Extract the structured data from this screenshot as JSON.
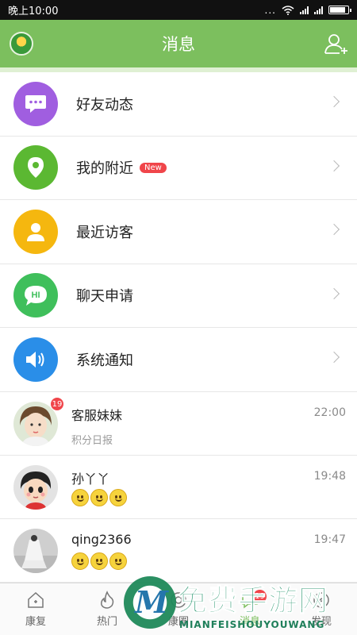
{
  "status_bar": {
    "time": "晚上10:00",
    "dots": "..."
  },
  "header": {
    "title": "消息"
  },
  "menu": [
    {
      "label": "好友动态",
      "icon": "chat-bubble-icon",
      "color": "#a05ee0"
    },
    {
      "label": "我的附近",
      "icon": "location-pin-icon",
      "color": "#5bb832",
      "badge": "New"
    },
    {
      "label": "最近访客",
      "icon": "person-icon",
      "color": "#f5b70f"
    },
    {
      "label": "聊天申请",
      "icon": "hi-bubble-icon",
      "color": "#3fbf5b",
      "glyph": "HI"
    },
    {
      "label": "系统通知",
      "icon": "speaker-icon",
      "color": "#2a8ee8"
    }
  ],
  "chats": [
    {
      "name": "客服妹妹",
      "time": "22:00",
      "message": "积分日报",
      "unread": "19"
    },
    {
      "name": "孙丫丫",
      "time": "19:48",
      "emoji_count": 3
    },
    {
      "name": "qing2366",
      "time": "19:47",
      "emoji_count": 3
    }
  ],
  "tabs": [
    {
      "label": "康复",
      "icon": "home-icon"
    },
    {
      "label": "热门",
      "icon": "flame-icon"
    },
    {
      "label": "康圈",
      "icon": "circle-icon"
    },
    {
      "label": "消息",
      "icon": "message-icon",
      "badge": "19",
      "active": true
    },
    {
      "label": "发现",
      "icon": "compass-icon"
    }
  ],
  "watermark": {
    "title": "免费手游网",
    "subtitle": "MIANFEISHOUYOUWANG"
  },
  "colors": {
    "header": "#7cbf5e",
    "badge": "#f0454a"
  }
}
